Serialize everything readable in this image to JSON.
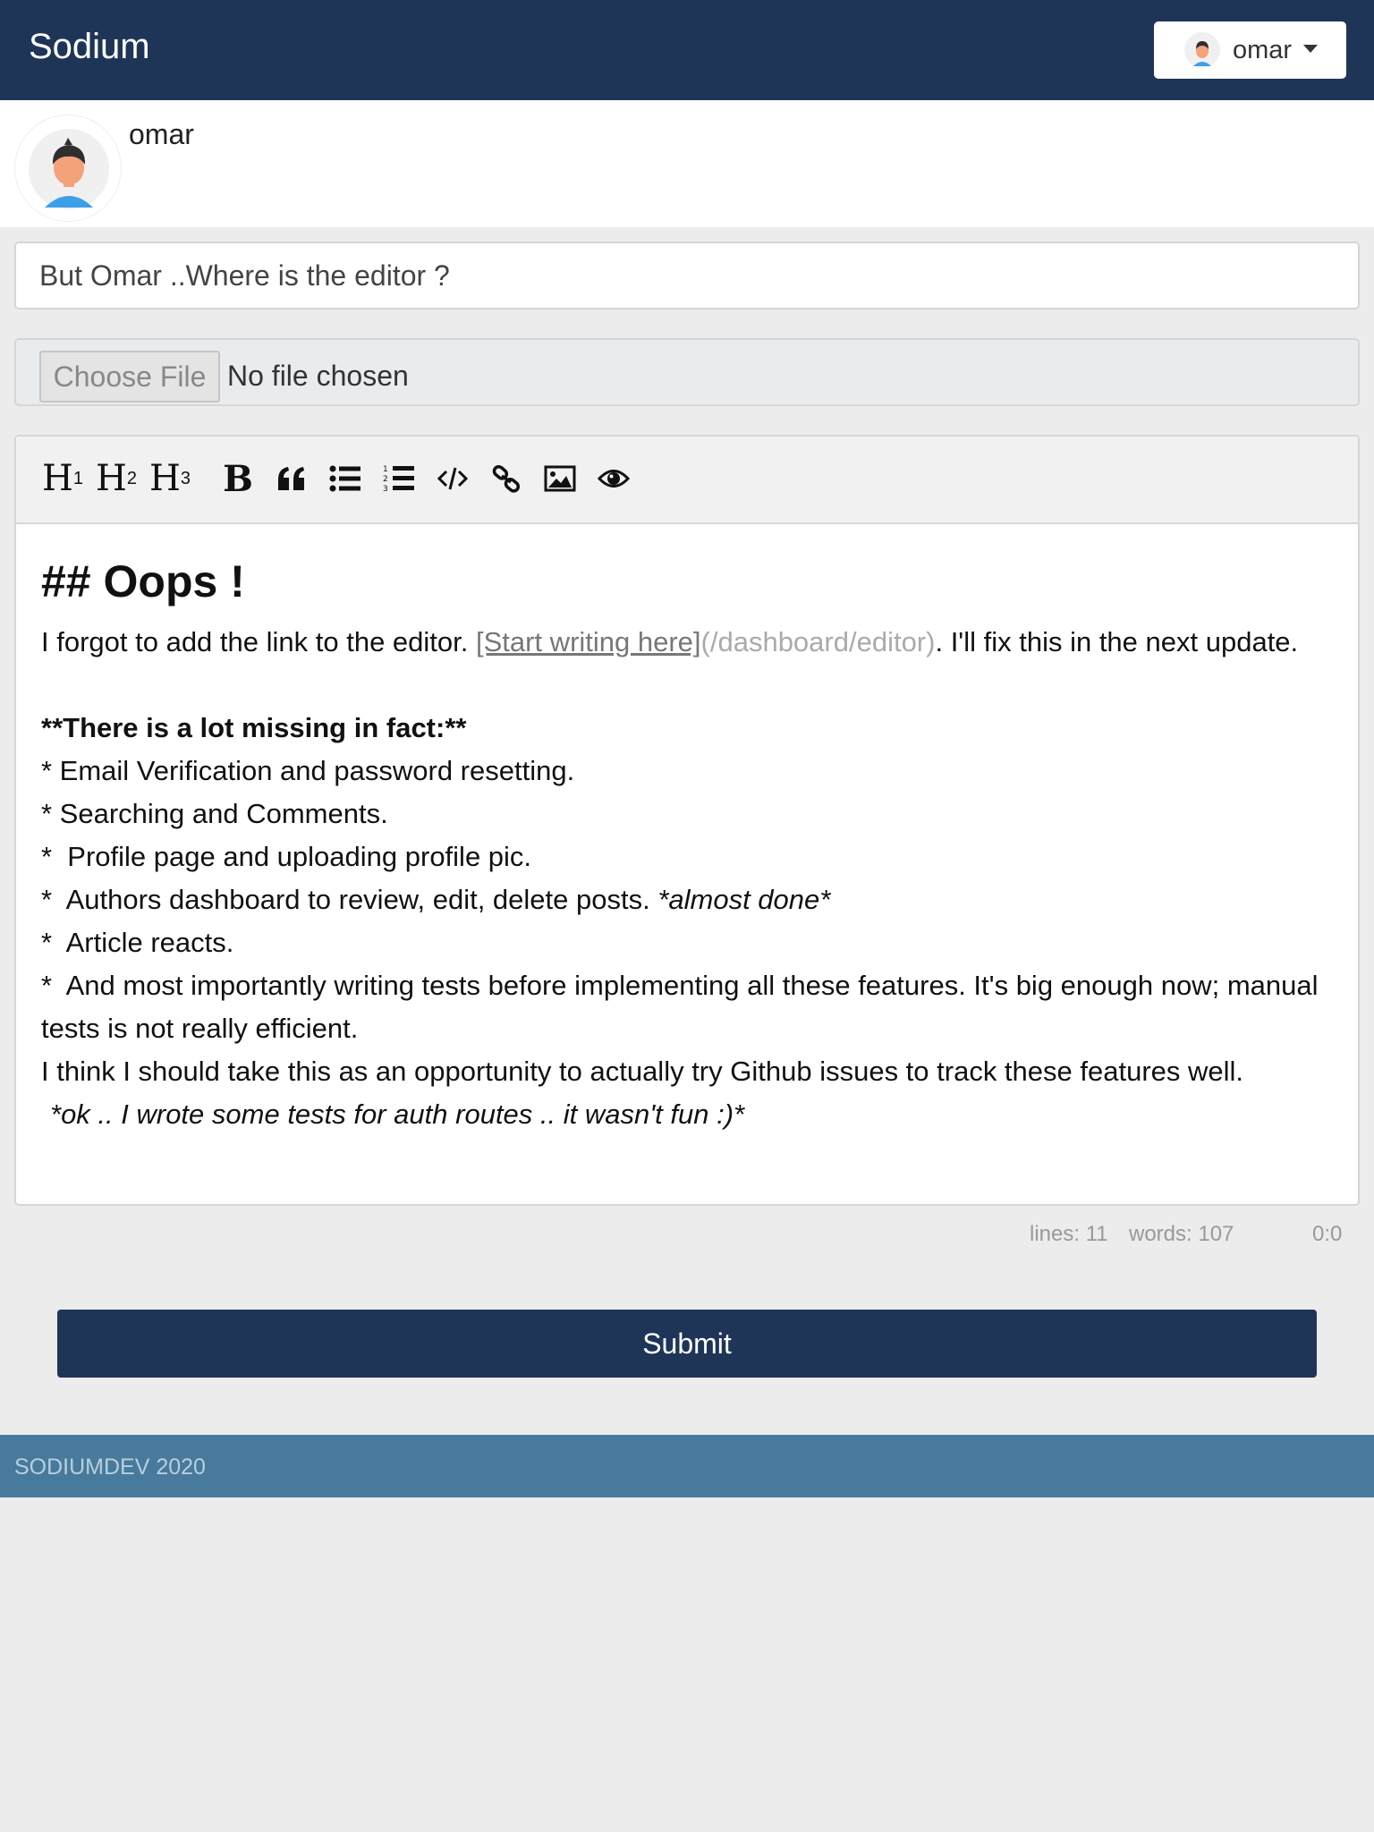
{
  "app": {
    "brand": "Sodium"
  },
  "header": {
    "user_name": "omar"
  },
  "profile": {
    "name": "omar"
  },
  "post": {
    "title": "But Omar ..Where is the editor ?"
  },
  "file_input": {
    "button_label": "Choose File",
    "status": "No file chosen"
  },
  "toolbar": {
    "items": [
      {
        "name": "heading-1-button",
        "label": "H",
        "sub": "1"
      },
      {
        "name": "heading-2-button",
        "label": "H",
        "sub": "2"
      },
      {
        "name": "heading-3-button",
        "label": "H",
        "sub": "3"
      },
      {
        "name": "bold-button",
        "label": "B"
      },
      {
        "name": "quote-button",
        "icon": "quote-icon"
      },
      {
        "name": "unordered-list-button",
        "icon": "unordered-list-icon"
      },
      {
        "name": "ordered-list-button",
        "icon": "ordered-list-icon"
      },
      {
        "name": "code-button",
        "icon": "code-icon"
      },
      {
        "name": "link-button",
        "icon": "link-icon"
      },
      {
        "name": "image-button",
        "icon": "image-icon"
      },
      {
        "name": "preview-button",
        "icon": "eye-icon"
      }
    ]
  },
  "editor": {
    "heading": "## Oops !",
    "line1_before": "I forgot to add the link to the editor. ",
    "line1_link": "[Start writing here]",
    "line1_url": "(/dashboard/editor)",
    "line1_after": ". I'll fix this in the next update.",
    "missing_heading": "**There is a lot missing in fact:**",
    "item1": "* Email Verification and password resetting.",
    "item2": "* Searching and Comments.",
    "item3": "*  Profile page and uploading profile pic.",
    "item4_text": "*  Authors dashboard to review, edit, delete posts. ",
    "item4_italic": "*almost done*",
    "item5": "*  Article reacts.",
    "item6": "*  And most importantly writing tests before implementing all these features. It's big enough now; manual tests is not really efficient.",
    "line_github": "I think I should take this as an opportunity to actually try Github issues to track these features well.",
    "line_last": "*ok .. I wrote some tests for auth routes .. it wasn't fun :)*"
  },
  "status": {
    "lines": "lines: 11",
    "words": "words: 107",
    "cursor": "0:0"
  },
  "submit": {
    "label": "Submit"
  },
  "footer": {
    "text": "SODIUMDEV 2020"
  }
}
